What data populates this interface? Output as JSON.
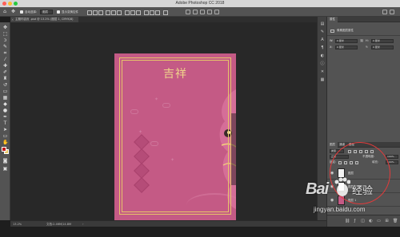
{
  "titlebar": {
    "title": "Adobe Photoshop CC 2018"
  },
  "options_bar": {
    "auto_select_label": "自动选择:",
    "auto_select_value": "图层",
    "show_transform_label": "显示变换控件",
    "icons": [
      "home-icon",
      "move-tool-icon",
      "align-icons",
      "3d-mode-icons"
    ]
  },
  "document_tab": {
    "title": "主题内容页 .psd @ 13.2% (图层 1, CMYK/8)"
  },
  "toolbox": {
    "tools": [
      "move",
      "marquee",
      "lasso",
      "quick-select",
      "crop",
      "eyedropper",
      "healing",
      "brush",
      "clone-stamp",
      "history-brush",
      "eraser",
      "gradient",
      "blur",
      "dodge",
      "pen",
      "type",
      "path-select",
      "shape",
      "hand",
      "zoom",
      "more"
    ],
    "foreground_color": "#c01b1b",
    "background_color": "#e8c868"
  },
  "canvas": {
    "artwork_title": "吉祥",
    "artwork_bg": "#c45a85",
    "frame_color": "#e6c46a"
  },
  "status_bar": {
    "zoom": "13.2%",
    "doc_size": "文档:2.46M/14.8M"
  },
  "properties_panel": {
    "tab": "属性",
    "section": "像素图层属性",
    "w_label": "W:",
    "w_value": "0 厘米",
    "h_label": "H:",
    "h_value": "0 厘米",
    "x_label": "X:",
    "x_value": "0 厘米",
    "y_label": "Y:",
    "y_value": "0 厘米",
    "link_label": "⛓"
  },
  "layers_panel": {
    "tabs": [
      "图层",
      "通道",
      "路径"
    ],
    "filter_value": "类型",
    "blend_mode": "正常",
    "opacity_label": "不透明度:",
    "opacity_value": "100%",
    "lock_label": "锁定:",
    "fill_label": "填充:",
    "fill_value": "100%",
    "layers": [
      {
        "name": "图层",
        "thumb": "#f2f2f2"
      },
      {
        "name": "图层 1 拷贝",
        "thumb": "#f2f2f2"
      },
      {
        "name": "图层 1",
        "thumb": "#c45a85"
      }
    ]
  },
  "watermark": {
    "logo": "Bai",
    "brand": "经验",
    "url": "jingyan.baidu.com"
  }
}
